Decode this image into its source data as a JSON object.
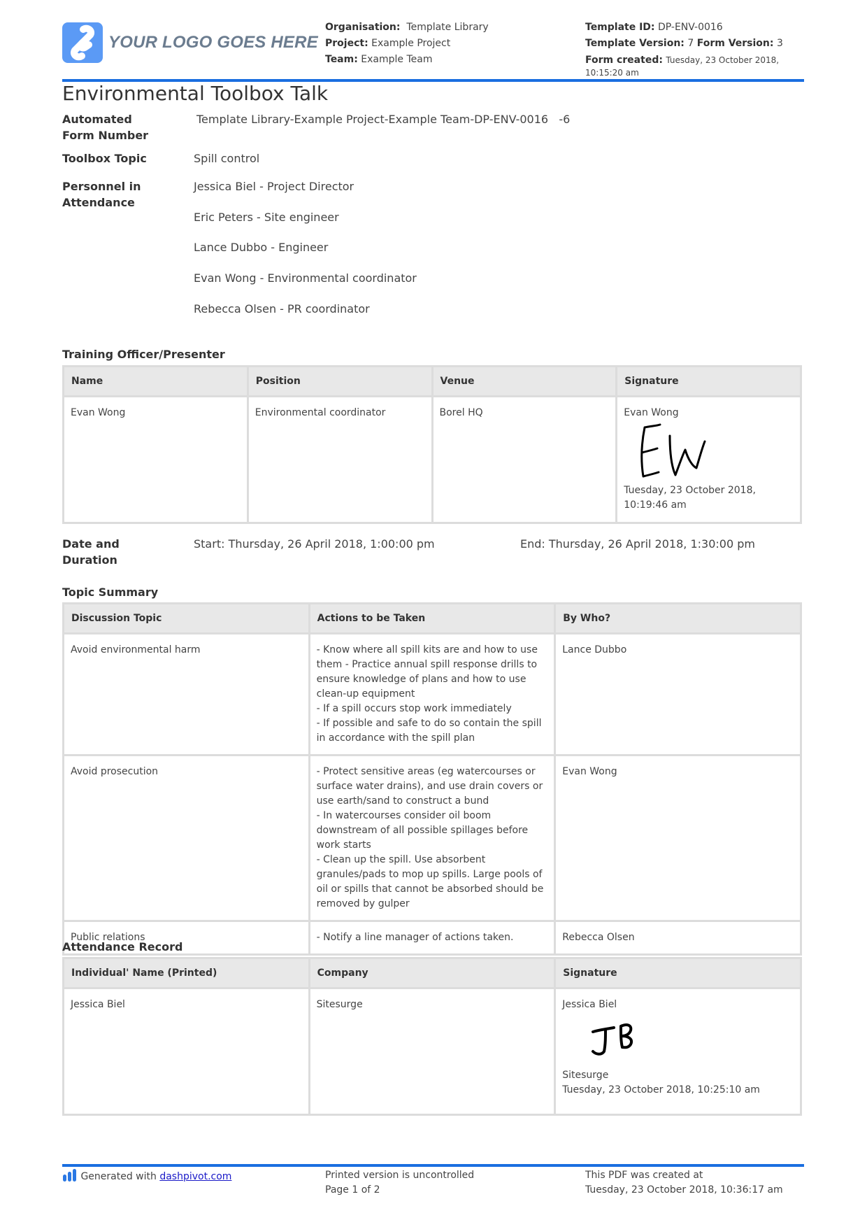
{
  "logo": {
    "icon": "logo-s-icon",
    "text": "YOUR LOGO GOES HERE"
  },
  "header": {
    "organisation_label": "Organisation:",
    "organisation_value": "Template Library",
    "project_label": "Project:",
    "project_value": "Example Project",
    "team_label": "Team:",
    "team_value": "Example Team",
    "template_id_label": "Template ID:",
    "template_id_value": "DP-ENV-0016",
    "template_version_label": "Template Version:",
    "template_version_value": "7",
    "form_version_label": "Form Version:",
    "form_version_value": "3",
    "form_created_label": "Form created:",
    "form_created_value": "Tuesday, 23 October 2018,",
    "form_created_value2": "10:15:20 am"
  },
  "title": "Environmental Toolbox Talk",
  "fields": {
    "form_number_label_1": "Automated",
    "form_number_label_2": "Form Number",
    "form_number_value": "Template Library-Example Project-Example Team-DP-ENV-0016   -6",
    "topic_label": "Toolbox Topic",
    "topic_value": "Spill control",
    "personnel_label_1": "Personnel in",
    "personnel_label_2": "Attendance",
    "personnel": [
      "Jessica Biel - Project Director",
      "Eric Peters - Site engineer",
      "Lance Dubbo - Engineer",
      "Evan Wong - Environmental coordinator",
      "Rebecca Olsen - PR coordinator"
    ]
  },
  "training": {
    "heading": "Training Officer/Presenter",
    "columns": [
      "Name",
      "Position",
      "Venue",
      "Signature"
    ],
    "row": {
      "name": "Evan Wong",
      "position": "Environmental coordinator",
      "venue": "Borel HQ",
      "signature_name": "Evan Wong",
      "signature_initials": "EW",
      "signature_time": "Tuesday, 23 October 2018, 10:19:46 am"
    }
  },
  "date_duration": {
    "label_1": "Date and",
    "label_2": "Duration",
    "start": "Start: Thursday, 26 April 2018, 1:00:00 pm",
    "end": "End: Thursday, 26 April 2018, 1:30:00 pm"
  },
  "topic_summary": {
    "heading": "Topic Summary",
    "columns": [
      "Discussion Topic",
      "Actions to be Taken",
      "By Who?"
    ],
    "rows": [
      {
        "topic": "Avoid environmental harm",
        "actions": [
          "- Know where all spill kits are and how to use them - Practice annual spill response drills to ensure knowledge of plans and how to use clean-up equipment",
          "- If a spill occurs stop work immediately",
          "- If possible and safe to do so contain the spill in accordance with the spill plan"
        ],
        "by": "Lance Dubbo"
      },
      {
        "topic": "Avoid prosecution",
        "actions": [
          "- Protect sensitive areas (eg watercourses or surface water drains), and use drain covers or use earth/sand to construct a bund",
          "- In watercourses consider oil boom downstream of all possible spillages before work starts",
          "- Clean up the spill. Use absorbent granules/pads to mop up spills. Large pools of oil or spills that cannot be absorbed should be removed by gulper"
        ],
        "by": "Evan Wong"
      },
      {
        "topic": "Public relations",
        "actions": [
          "- Notify a line manager of actions taken."
        ],
        "by": "Rebecca Olsen"
      }
    ]
  },
  "attendance": {
    "heading": "Attendance Record",
    "columns": [
      "Individual' Name (Printed)",
      "Company",
      "Signature"
    ],
    "row": {
      "name": "Jessica Biel",
      "company": "Sitesurge",
      "signature_name": "Jessica Biel",
      "signature_initials": "JB",
      "signature_company": "Sitesurge",
      "signature_time": "Tuesday, 23 October 2018, 10:25:10 am"
    }
  },
  "footer": {
    "icon": "dashpivot-bars-icon",
    "generated_prefix": "Generated with ",
    "generated_link": "dashpivot.com",
    "uncontrolled": "Printed version is uncontrolled",
    "page": "Page 1 of 2",
    "pdf_created_label": "This PDF was created at",
    "pdf_created_value": "Tuesday, 23 October 2018, 10:36:17 am"
  },
  "colors": {
    "accent_blue": "#1a6ee0",
    "logo_blue": "#5b9af5",
    "table_border": "#dcdcdc",
    "table_header_bg": "#e8e8e8",
    "link": "#1a1ac8"
  }
}
